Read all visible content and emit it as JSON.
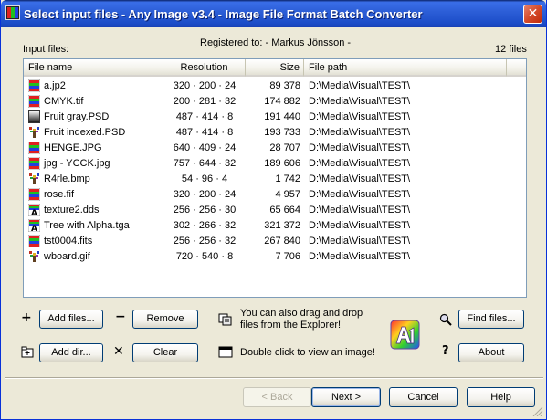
{
  "window": {
    "title": "Select input files - Any Image v3.4 - Image File Format Batch Converter",
    "close_glyph": "✕"
  },
  "header": {
    "input_files_label": "Input files:",
    "registered_to": "Registered to: - Markus Jönsson -",
    "file_count": "12 files"
  },
  "columns": [
    "File name",
    "Resolution",
    "Size",
    "File path"
  ],
  "files": [
    {
      "name": "a.jp2",
      "resolution": "320 · 200 · 24",
      "size": "89 378",
      "path": "D:\\Media\\Visual\\TEST\\",
      "icon": "colorbars-icon"
    },
    {
      "name": "CMYK.tif",
      "resolution": "200 · 281 · 32",
      "size": "174 882",
      "path": "D:\\Media\\Visual\\TEST\\",
      "icon": "colorbars-icon"
    },
    {
      "name": "Fruit gray.PSD",
      "resolution": "487 · 414 · 8",
      "size": "191 440",
      "path": "D:\\Media\\Visual\\TEST\\",
      "icon": "grayscale-icon"
    },
    {
      "name": "Fruit indexed.PSD",
      "resolution": "487 · 414 · 8",
      "size": "193 733",
      "path": "D:\\Media\\Visual\\TEST\\",
      "icon": "palette-icon"
    },
    {
      "name": "HENGE.JPG",
      "resolution": "640 · 409 · 24",
      "size": "28 707",
      "path": "D:\\Media\\Visual\\TEST\\",
      "icon": "colorbars-icon"
    },
    {
      "name": "jpg - YCCK.jpg",
      "resolution": "757 · 644 · 32",
      "size": "189 606",
      "path": "D:\\Media\\Visual\\TEST\\",
      "icon": "colorbars-icon"
    },
    {
      "name": "R4rle.bmp",
      "resolution": "54 · 96 · 4",
      "size": "1 742",
      "path": "D:\\Media\\Visual\\TEST\\",
      "icon": "palette-icon"
    },
    {
      "name": "rose.fif",
      "resolution": "320 · 200 · 24",
      "size": "4 957",
      "path": "D:\\Media\\Visual\\TEST\\",
      "icon": "colorbars-icon"
    },
    {
      "name": "texture2.dds",
      "resolution": "256 · 256 · 30",
      "size": "65 664",
      "path": "D:\\Media\\Visual\\TEST\\",
      "icon": "alpha-icon"
    },
    {
      "name": "Tree with Alpha.tga",
      "resolution": "302 · 266 · 32",
      "size": "321 372",
      "path": "D:\\Media\\Visual\\TEST\\",
      "icon": "alpha-icon"
    },
    {
      "name": "tst0004.fits",
      "resolution": "256 · 256 · 32",
      "size": "267 840",
      "path": "D:\\Media\\Visual\\TEST\\",
      "icon": "colorbars-icon"
    },
    {
      "name": "wboard.gif",
      "resolution": "720 · 540 · 8",
      "size": "7 706",
      "path": "D:\\Media\\Visual\\TEST\\",
      "icon": "palette-icon"
    }
  ],
  "actions": {
    "add_files": "Add files...",
    "remove": "Remove",
    "add_dir": "Add dir...",
    "clear": "Clear",
    "find_files": "Find files...",
    "about": "About"
  },
  "hints": {
    "drag_drop_line1": "You can also drag and drop",
    "drag_drop_line2": "files from the Explorer!",
    "double_click": "Double click to view an image!"
  },
  "icons": {
    "plus": "+",
    "minus": "−",
    "cross": "✕",
    "question": "?"
  },
  "footer": {
    "back": "< Back",
    "next": "Next >",
    "cancel": "Cancel",
    "help": "Help"
  },
  "colors": {
    "titlebar": "#2d5fd8",
    "dialog_bg": "#ece9d8",
    "button_border": "#003c74"
  }
}
